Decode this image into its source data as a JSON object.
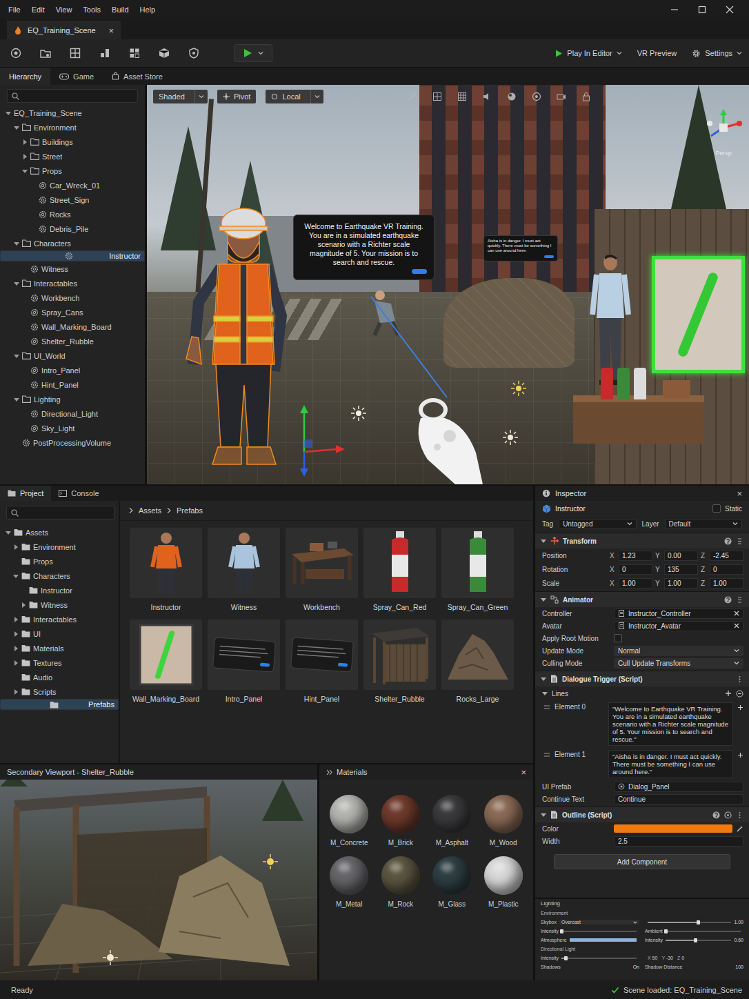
{
  "menu": [
    "File",
    "Edit",
    "View",
    "Tools",
    "Build",
    "Help"
  ],
  "doc_tab": {
    "label": "EQ_Training_Scene",
    "close": "×",
    "selected": true
  },
  "toolbar": {
    "play_in_editor": "Play In Editor",
    "vr_preview": "VR Preview",
    "settings": "Settings"
  },
  "left_tabs": [
    {
      "label": "Hierarchy",
      "selected": true
    },
    {
      "label": "Game",
      "selected": false
    },
    {
      "label": "Asset Store",
      "selected": false
    }
  ],
  "hierarchy": {
    "search_placeholder": "",
    "items": [
      {
        "label": "EQ_Training_Scene",
        "depth": 0,
        "kind": "scene",
        "has_children": true,
        "expanded": true,
        "selected": false
      },
      {
        "label": "Environment",
        "depth": 1,
        "kind": "folder",
        "has_children": true,
        "expanded": true,
        "selected": false
      },
      {
        "label": "Buildings",
        "depth": 2,
        "kind": "folder",
        "has_children": true,
        "expanded": false,
        "selected": false
      },
      {
        "label": "Street",
        "depth": 2,
        "kind": "folder",
        "has_children": true,
        "expanded": false,
        "selected": false
      },
      {
        "label": "Props",
        "depth": 2,
        "kind": "folder",
        "has_children": true,
        "expanded": true,
        "selected": false
      },
      {
        "label": "Car_Wreck_01",
        "depth": 3,
        "kind": "object",
        "has_children": false,
        "expanded": false,
        "selected": false
      },
      {
        "label": "Street_Sign",
        "depth": 3,
        "kind": "object",
        "has_children": false,
        "expanded": false,
        "selected": false
      },
      {
        "label": "Rocks",
        "depth": 3,
        "kind": "object",
        "has_children": false,
        "expanded": false,
        "selected": false
      },
      {
        "label": "Debris_Pile",
        "depth": 3,
        "kind": "object",
        "has_children": false,
        "expanded": false,
        "selected": false
      },
      {
        "label": "Characters",
        "depth": 1,
        "kind": "folder",
        "has_children": true,
        "expanded": true,
        "selected": false
      },
      {
        "label": "Instructor",
        "depth": 2,
        "kind": "object",
        "has_children": false,
        "expanded": false,
        "selected": true
      },
      {
        "label": "Witness",
        "depth": 2,
        "kind": "object",
        "has_children": false,
        "expanded": false,
        "selected": false
      },
      {
        "label": "Interactables",
        "depth": 1,
        "kind": "folder",
        "has_children": true,
        "expanded": true,
        "selected": false
      },
      {
        "label": "Workbench",
        "depth": 2,
        "kind": "object",
        "has_children": false,
        "expanded": false,
        "selected": false
      },
      {
        "label": "Spray_Cans",
        "depth": 2,
        "kind": "object",
        "has_children": false,
        "expanded": false,
        "selected": false
      },
      {
        "label": "Wall_Marking_Board",
        "depth": 2,
        "kind": "object",
        "has_children": false,
        "expanded": false,
        "selected": false
      },
      {
        "label": "Shelter_Rubble",
        "depth": 2,
        "kind": "object",
        "has_children": false,
        "expanded": false,
        "selected": false
      },
      {
        "label": "UI_World",
        "depth": 1,
        "kind": "folder",
        "has_children": true,
        "expanded": true,
        "selected": false
      },
      {
        "label": "Intro_Panel",
        "depth": 2,
        "kind": "object",
        "has_children": false,
        "expanded": false,
        "selected": false
      },
      {
        "label": "Hint_Panel",
        "depth": 2,
        "kind": "object",
        "has_children": false,
        "expanded": false,
        "selected": false
      },
      {
        "label": "Lighting",
        "depth": 1,
        "kind": "folder",
        "has_children": true,
        "expanded": true,
        "selected": false
      },
      {
        "label": "Directional_Light",
        "depth": 2,
        "kind": "object",
        "has_children": false,
        "expanded": false,
        "selected": false
      },
      {
        "label": "Sky_Light",
        "depth": 2,
        "kind": "object",
        "has_children": false,
        "expanded": false,
        "selected": false
      },
      {
        "label": "PostProcessingVolume",
        "depth": 1,
        "kind": "object",
        "has_children": false,
        "expanded": false,
        "selected": false
      }
    ]
  },
  "viewport": {
    "buttons": [
      {
        "label": "Shaded",
        "dropdown": true
      },
      {
        "label": "Pivot",
        "dropdown": false
      },
      {
        "label": "Local",
        "dropdown": true
      }
    ],
    "intro_panel": "Welcome to Earthquake VR Training. You are in a simulated earthquake scenario with a Richter scale magnitude of 5. Your mission is to search and rescue.",
    "hint_panel": "Aisha is in danger. I must act quickly. There must be something I can use around here.",
    "camera_label": "Persp"
  },
  "project": {
    "tabs": [
      {
        "label": "Project",
        "selected": true
      },
      {
        "label": "Console",
        "selected": false
      }
    ],
    "search_placeholder": "",
    "tree": [
      {
        "label": "Assets",
        "depth": 0,
        "has_children": true,
        "expanded": true,
        "selected": false
      },
      {
        "label": "Environment",
        "depth": 1,
        "has_children": true,
        "expanded": false,
        "selected": false
      },
      {
        "label": "Props",
        "depth": 1,
        "has_children": false,
        "expanded": false,
        "selected": false
      },
      {
        "label": "Characters",
        "depth": 1,
        "has_children": true,
        "expanded": true,
        "selected": false
      },
      {
        "label": "Instructor",
        "depth": 2,
        "has_children": false,
        "expanded": false,
        "selected": false
      },
      {
        "label": "Witness",
        "depth": 2,
        "has_children": true,
        "expanded": false,
        "selected": false
      },
      {
        "label": "Interactables",
        "depth": 1,
        "has_children": true,
        "expanded": false,
        "selected": false
      },
      {
        "label": "UI",
        "depth": 1,
        "has_children": true,
        "expanded": false,
        "selected": false
      },
      {
        "label": "Materials",
        "depth": 1,
        "has_children": true,
        "expanded": false,
        "selected": false
      },
      {
        "label": "Textures",
        "depth": 1,
        "has_children": true,
        "expanded": false,
        "selected": false
      },
      {
        "label": "Audio",
        "depth": 1,
        "has_children": false,
        "expanded": false,
        "selected": false
      },
      {
        "label": "Scripts",
        "depth": 1,
        "has_children": true,
        "expanded": false,
        "selected": false
      },
      {
        "label": "Prefabs",
        "depth": 1,
        "has_children": false,
        "expanded": false,
        "selected": true
      }
    ],
    "breadcrumb": [
      "Assets",
      "Prefabs"
    ],
    "prefabs": [
      {
        "name": "Instructor",
        "kind": "figure",
        "color": "#e0621c"
      },
      {
        "name": "Witness",
        "kind": "figure",
        "color": "#a9c4dc"
      },
      {
        "name": "Workbench",
        "kind": "bench",
        "color": "#6b4a32"
      },
      {
        "name": "Spray_Can_Red",
        "kind": "can",
        "color": "#c62a2a"
      },
      {
        "name": "Spray_Can_Green",
        "kind": "can",
        "color": "#3a8a3a"
      },
      {
        "name": "Wall_Marking_Board",
        "kind": "board",
        "color": "#3ed43e"
      },
      {
        "name": "Intro_Panel",
        "kind": "panel",
        "color": "#1a1a1a"
      },
      {
        "name": "Hint_Panel",
        "kind": "panel",
        "color": "#1a1a1a"
      },
      {
        "name": "Shelter_Rubble",
        "kind": "shelter",
        "color": "#5a4a3a"
      },
      {
        "name": "Rocks_Large",
        "kind": "rocks",
        "color": "#6b5a48"
      }
    ]
  },
  "secondary_viewport": {
    "title": "Secondary Viewport - Shelter_Rubble"
  },
  "materials": {
    "title": "Materials",
    "close": "×",
    "items": [
      {
        "name": "M_Concrete",
        "color": "#b4b4b0"
      },
      {
        "name": "M_Brick",
        "color": "#6e3a2c"
      },
      {
        "name": "M_Asphalt",
        "color": "#3a3a3c"
      },
      {
        "name": "M_Wood",
        "color": "#8a6a55"
      },
      {
        "name": "M_Metal",
        "color": "#66666a"
      },
      {
        "name": "M_Rock",
        "color": "#5b5640"
      },
      {
        "name": "M_Glass",
        "color": "#2e3e42"
      },
      {
        "name": "M_Plastic",
        "color": "#d8d8d8"
      }
    ]
  },
  "inspector": {
    "title": "Inspector",
    "close": "×",
    "object": {
      "name": "Instructor",
      "static_label": "Static",
      "static": false
    },
    "tag": {
      "label": "Tag",
      "value": "Untagged"
    },
    "layer": {
      "label": "Layer",
      "value": "Default"
    },
    "transform": {
      "title": "Transform",
      "expanded": true,
      "rows": [
        {
          "label": "Position",
          "values": [
            {
              "axis": "X",
              "value": "1.23"
            },
            {
              "axis": "Y",
              "value": "0.00"
            },
            {
              "axis": "Z",
              "value": "-2.45"
            }
          ]
        },
        {
          "label": "Rotation",
          "values": [
            {
              "axis": "X",
              "value": "0"
            },
            {
              "axis": "Y",
              "value": "135"
            },
            {
              "axis": "Z",
              "value": "0"
            }
          ]
        },
        {
          "label": "Scale",
          "values": [
            {
              "axis": "X",
              "value": "1.00"
            },
            {
              "axis": "Y",
              "value": "1.00"
            },
            {
              "axis": "Z",
              "value": "1.00"
            }
          ]
        }
      ]
    },
    "animator": {
      "title": "Animator",
      "expanded": true,
      "rows": [
        {
          "label": "Controller",
          "kind": "object",
          "value": "Instructor_Controller"
        },
        {
          "label": "Avatar",
          "kind": "object",
          "value": "Instructor_Avatar"
        },
        {
          "label": "Apply Root Motion",
          "kind": "checkbox",
          "checked": false
        },
        {
          "label": "Update Mode",
          "kind": "select",
          "value": "Normal"
        },
        {
          "label": "Culling Mode",
          "kind": "select",
          "value": "Cull Update Transforms"
        }
      ]
    },
    "dialogue": {
      "title": "Dialogue Trigger (Script)",
      "expanded": true,
      "lines_label": "Lines",
      "lines_expanded": true,
      "elements": [
        {
          "label": "Element 0",
          "value": "\"Welcome to Earthquake VR Training. You are in a simulated earthquake scenario with a Richter scale magnitude of 5. Your mission is to search and rescue.\""
        },
        {
          "label": "Element 1",
          "value": "\"Aisha is in danger. I must act quickly. There must be something I can use around here.\""
        }
      ],
      "ui_prefab": {
        "label": "UI Prefab",
        "value": "Dialog_Panel"
      },
      "continue_text": {
        "label": "Continue Text",
        "value": "Continue"
      }
    },
    "outline": {
      "title": "Outline (Script)",
      "expanded": true,
      "color_label": "Color",
      "color": "#f07a10",
      "width_label": "Width",
      "width": "2.5"
    },
    "add_component": "Add Component"
  },
  "lighting": {
    "title": "Lighting",
    "rows": [
      {
        "kind": "heading",
        "label": "Environment",
        "cells": []
      },
      {
        "kind": "pair",
        "label": "",
        "cells": [
          {
            "kind": "select",
            "label": "Skybox",
            "value": "Overcast",
            "level": 0
          },
          {
            "kind": "slider",
            "label": "",
            "value": "1.00",
            "level": 0.6
          }
        ]
      },
      {
        "kind": "pair",
        "label": "",
        "cells": [
          {
            "kind": "slider",
            "label": "Intensity",
            "value": "",
            "level": 0
          },
          {
            "kind": "slider",
            "label": "Ambient",
            "value": "",
            "level": 0
          }
        ]
      },
      {
        "kind": "pair",
        "label": "",
        "cells": [
          {
            "kind": "bar",
            "label": "Atmosphere",
            "value": "",
            "level": 1
          },
          {
            "kind": "slider",
            "label": "Intensity",
            "value": "0.60",
            "level": 0.45
          }
        ]
      },
      {
        "kind": "heading",
        "label": "Directional Light",
        "cells": []
      },
      {
        "kind": "pair",
        "label": "",
        "cells": [
          {
            "kind": "slider",
            "label": "Intensity",
            "value": "",
            "level": 0.05
          },
          {
            "kind": "xyz",
            "label": "",
            "value": "",
            "level": 0,
            "axes": [
              {
                "axis": "X",
                "value": "50"
              },
              {
                "axis": "Y",
                "value": "-30"
              },
              {
                "axis": "Z",
                "value": "0"
              }
            ]
          }
        ]
      },
      {
        "kind": "pair",
        "label": "",
        "cells": [
          {
            "kind": "text",
            "label": "Shadows",
            "value": "On",
            "level": 0
          },
          {
            "kind": "text",
            "label": "Shadow Distance",
            "value": "100",
            "level": 0
          }
        ]
      }
    ]
  },
  "status_bar": {
    "left": "Ready",
    "right": "Scene loaded: EQ_Training_Scene"
  }
}
